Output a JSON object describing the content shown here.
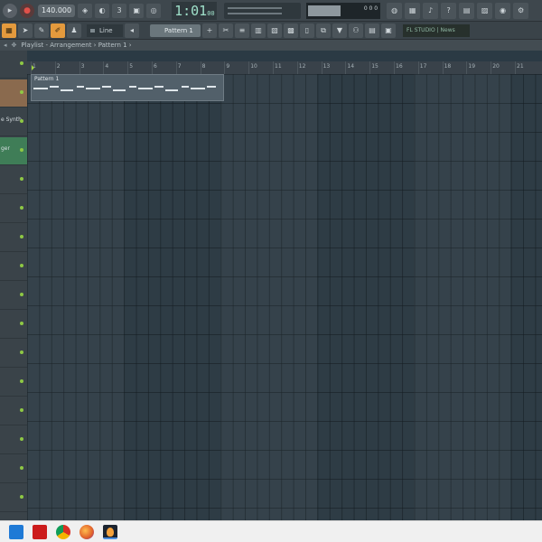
{
  "transport": {
    "tempo": "140.000",
    "song_position": "1:01",
    "song_position_ticks": "00",
    "cpu_value": "0 0 0"
  },
  "toolbar": {
    "snap_label": "Line",
    "pattern_selector": "Pattern 1",
    "hint_text": "FL STUDIO | News"
  },
  "playlist": {
    "breadcrumb": "Playlist - Arrangement › Pattern 1 ›"
  },
  "ruler": {
    "bars": [
      "1",
      "2",
      "3",
      "4",
      "5",
      "6",
      "7",
      "8",
      "9",
      "10",
      "11",
      "12",
      "13",
      "14",
      "15",
      "16",
      "17",
      "18",
      "19",
      "20",
      "21"
    ]
  },
  "tracks": [
    {
      "label": "",
      "color": "#8a6a4e"
    },
    {
      "label": "e Synth",
      "color": ""
    },
    {
      "label": "ger",
      "color": "#3f7d57"
    }
  ],
  "clip": {
    "name": "Pattern 1"
  },
  "taskbar": {
    "apps": [
      "file-explorer",
      "netflix",
      "chrome",
      "firefox",
      "fl-studio"
    ]
  },
  "colors": {
    "accent": "#e49a3d",
    "led": "#8ec844",
    "grid": "#2e3c45"
  }
}
